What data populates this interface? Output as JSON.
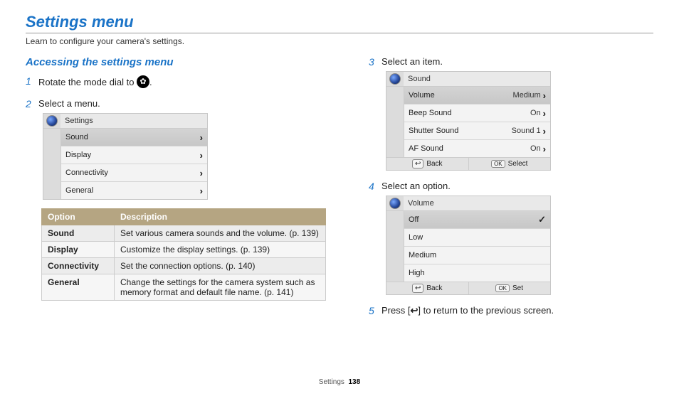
{
  "title": "Settings menu",
  "subtitle": "Learn to configure your camera's settings.",
  "section_heading": "Accessing the settings menu",
  "steps": {
    "s1_pre": "Rotate the mode dial to ",
    "s1_post": ".",
    "s2": "Select a menu.",
    "s3": "Select an item.",
    "s4": "Select an option.",
    "s5_pre": "Press [",
    "s5_post": "] to return to the previous screen."
  },
  "screen1": {
    "header": "Settings",
    "rows": [
      "Sound",
      "Display",
      "Connectivity",
      "General"
    ]
  },
  "desc_table": {
    "headers": [
      "Option",
      "Description"
    ],
    "rows": [
      {
        "opt": "Sound",
        "desc": "Set various camera sounds and the volume. (p. 139)"
      },
      {
        "opt": "Display",
        "desc": "Customize the display settings. (p. 139)"
      },
      {
        "opt": "Connectivity",
        "desc": "Set the connection options. (p. 140)"
      },
      {
        "opt": "General",
        "desc": "Change the settings for the camera system such as memory format and default file name. (p. 141)"
      }
    ]
  },
  "screen2": {
    "header": "Sound",
    "rows": [
      {
        "label": "Volume",
        "value": "Medium",
        "hl": true
      },
      {
        "label": "Beep Sound",
        "value": "On"
      },
      {
        "label": "Shutter Sound",
        "value": "Sound 1"
      },
      {
        "label": "AF Sound",
        "value": "On"
      }
    ],
    "footer": {
      "back": "Back",
      "ok_key": "OK",
      "action": "Select"
    }
  },
  "screen3": {
    "header": "Volume",
    "rows": [
      "Off",
      "Low",
      "Medium",
      "High"
    ],
    "highlight_index": 0,
    "footer": {
      "back": "Back",
      "ok_key": "OK",
      "action": "Set"
    }
  },
  "footer": {
    "label": "Settings",
    "page": "138"
  }
}
